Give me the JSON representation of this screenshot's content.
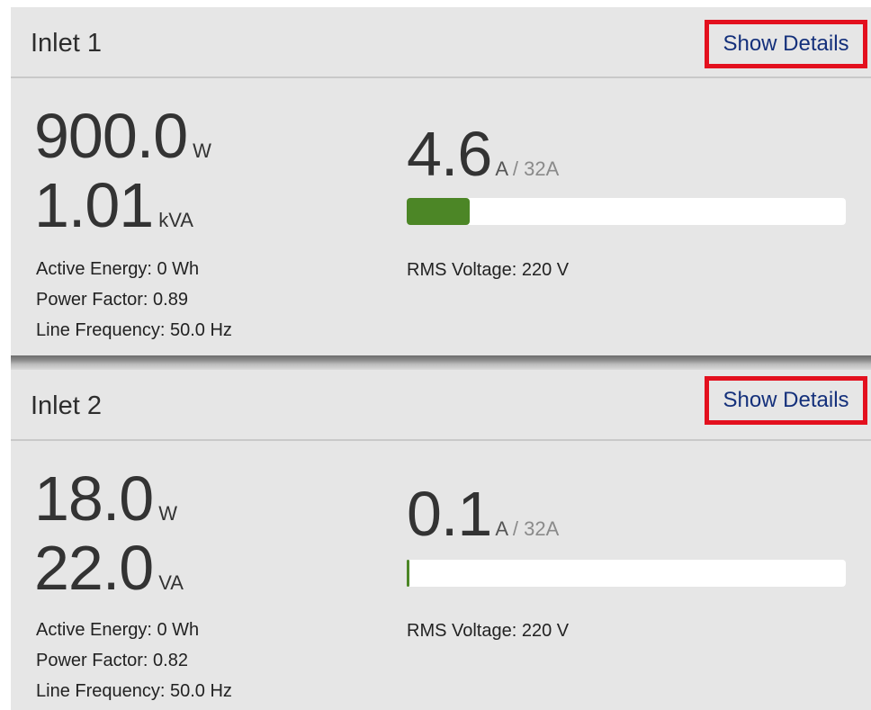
{
  "inlets": [
    {
      "title": "Inlet 1",
      "show_details_label": "Show Details",
      "active_power": {
        "value": "900.0",
        "unit": "W"
      },
      "apparent_power": {
        "value": "1.01",
        "unit": "kVA"
      },
      "current": {
        "value": "4.6",
        "unit": "A",
        "rating": "/ 32A",
        "fraction": 0.144
      },
      "active_energy": "Active Energy: 0 Wh",
      "power_factor": "Power Factor: 0.89",
      "line_frequency": "Line Frequency: 50.0 Hz",
      "rms_voltage": "RMS Voltage: 220 V",
      "bar_color": "#4c8626"
    },
    {
      "title": "Inlet 2",
      "show_details_label": "Show Details",
      "active_power": {
        "value": "18.0",
        "unit": "W"
      },
      "apparent_power": {
        "value": "22.0",
        "unit": "VA"
      },
      "current": {
        "value": "0.1",
        "unit": "A",
        "rating": "/ 32A",
        "fraction": 0.003
      },
      "active_energy": "Active Energy: 0 Wh",
      "power_factor": "Power Factor: 0.82",
      "line_frequency": "Line Frequency: 50.0 Hz",
      "rms_voltage": "RMS Voltage: 220 V",
      "bar_color": "#4c8626"
    }
  ],
  "highlight_color": "#e3101e",
  "link_color": "#14307b"
}
